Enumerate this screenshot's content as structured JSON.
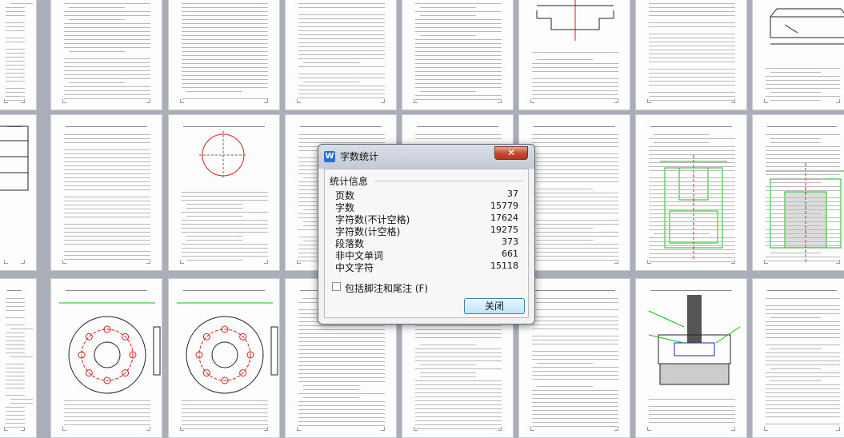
{
  "dialog": {
    "title": "字数统计",
    "app_icon": "W",
    "close_glyph": "✕",
    "group_label": "统计信息",
    "stats": [
      {
        "label": "页数",
        "value": "37"
      },
      {
        "label": "字数",
        "value": "15779"
      },
      {
        "label": "字符数(不计空格)",
        "value": "17624"
      },
      {
        "label": "字符数(计空格)",
        "value": "19275"
      },
      {
        "label": "段落数",
        "value": "373"
      },
      {
        "label": "非中文单词",
        "value": "661"
      },
      {
        "label": "中文字符",
        "value": "15118"
      }
    ],
    "checkbox_label": "包括脚注和尾注",
    "checkbox_hotkey": "(F)",
    "checkbox_checked": false,
    "close_button_label": "关闭"
  },
  "colors": {
    "background": "#a9aeb8",
    "drawing_green": "#10c010",
    "drawing_red": "#d02020",
    "dialog_close": "#c6452c"
  }
}
